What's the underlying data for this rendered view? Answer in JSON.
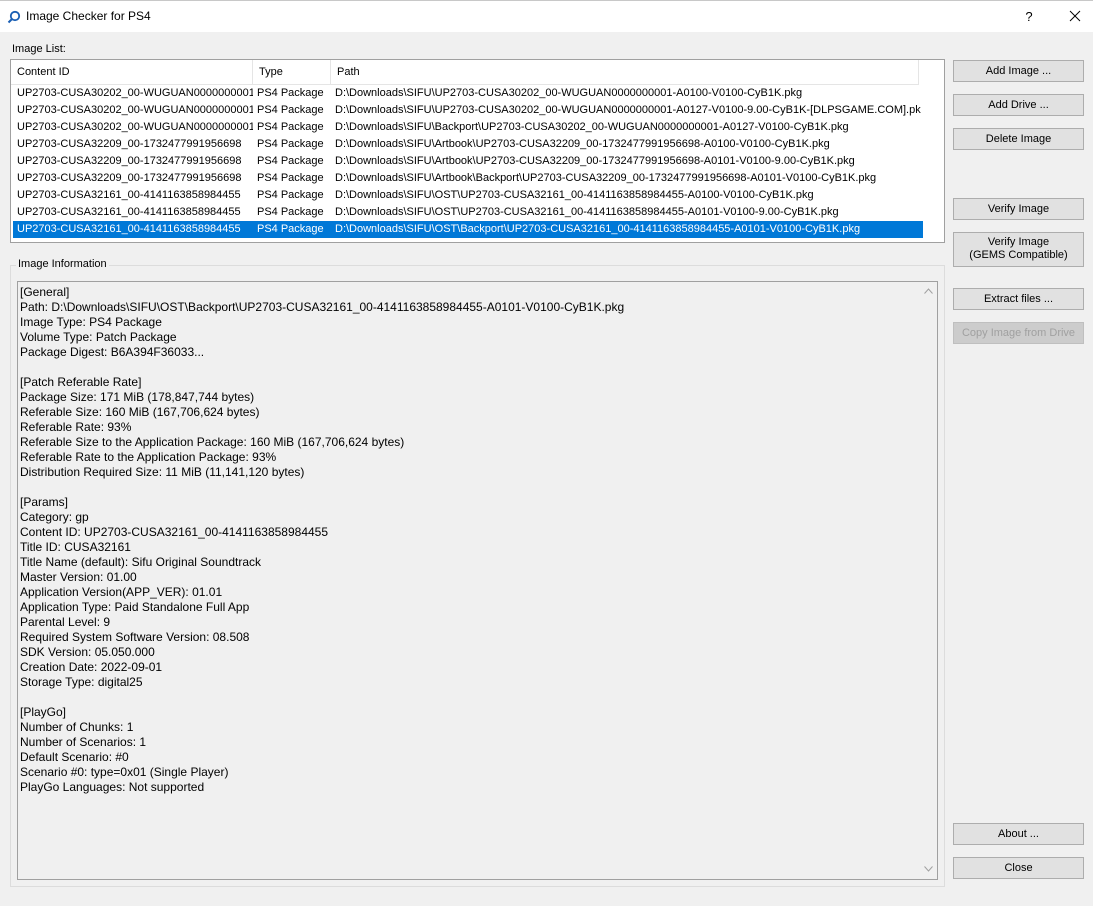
{
  "window": {
    "title": "Image Checker for PS4",
    "help_label": "?"
  },
  "image_list": {
    "label": "Image List:",
    "columns": [
      "Content ID",
      "Type",
      "Path"
    ],
    "rows": [
      [
        "UP2703-CUSA30202_00-WUGUAN0000000001",
        "PS4 Package",
        "D:\\Downloads\\SIFU\\UP2703-CUSA30202_00-WUGUAN0000000001-A0100-V0100-CyB1K.pkg"
      ],
      [
        "UP2703-CUSA30202_00-WUGUAN0000000001",
        "PS4 Package",
        "D:\\Downloads\\SIFU\\UP2703-CUSA30202_00-WUGUAN0000000001-A0127-V0100-9.00-CyB1K-[DLPSGAME.COM].pkg"
      ],
      [
        "UP2703-CUSA30202_00-WUGUAN0000000001",
        "PS4 Package",
        "D:\\Downloads\\SIFU\\Backport\\UP2703-CUSA30202_00-WUGUAN0000000001-A0127-V0100-CyB1K.pkg"
      ],
      [
        "UP2703-CUSA32209_00-1732477991956698",
        "PS4 Package",
        "D:\\Downloads\\SIFU\\Artbook\\UP2703-CUSA32209_00-1732477991956698-A0100-V0100-CyB1K.pkg"
      ],
      [
        "UP2703-CUSA32209_00-1732477991956698",
        "PS4 Package",
        "D:\\Downloads\\SIFU\\Artbook\\UP2703-CUSA32209_00-1732477991956698-A0101-V0100-9.00-CyB1K.pkg"
      ],
      [
        "UP2703-CUSA32209_00-1732477991956698",
        "PS4 Package",
        "D:\\Downloads\\SIFU\\Artbook\\Backport\\UP2703-CUSA32209_00-1732477991956698-A0101-V0100-CyB1K.pkg"
      ],
      [
        "UP2703-CUSA32161_00-4141163858984455",
        "PS4 Package",
        "D:\\Downloads\\SIFU\\OST\\UP2703-CUSA32161_00-4141163858984455-A0100-V0100-CyB1K.pkg"
      ],
      [
        "UP2703-CUSA32161_00-4141163858984455",
        "PS4 Package",
        "D:\\Downloads\\SIFU\\OST\\UP2703-CUSA32161_00-4141163858984455-A0101-V0100-9.00-CyB1K.pkg"
      ],
      [
        "UP2703-CUSA32161_00-4141163858984455",
        "PS4 Package",
        "D:\\Downloads\\SIFU\\OST\\Backport\\UP2703-CUSA32161_00-4141163858984455-A0101-V0100-CyB1K.pkg"
      ]
    ],
    "selected_row": 8
  },
  "image_information": {
    "label": "Image Information",
    "text": "[General]\nPath: D:\\Downloads\\SIFU\\OST\\Backport\\UP2703-CUSA32161_00-4141163858984455-A0101-V0100-CyB1K.pkg\nImage Type: PS4 Package\nVolume Type: Patch Package\nPackage Digest: B6A394F36033...\n\n[Patch Referable Rate]\nPackage Size: 171 MiB (178,847,744 bytes)\nReferable Size: 160 MiB (167,706,624 bytes)\nReferable Rate: 93%\nReferable Size to the Application Package: 160 MiB (167,706,624 bytes)\nReferable Rate to the Application Package: 93%\nDistribution Required Size: 11 MiB (11,141,120 bytes)\n\n[Params]\nCategory: gp\nContent ID: UP2703-CUSA32161_00-4141163858984455\nTitle ID: CUSA32161\nTitle Name (default): Sifu Original Soundtrack\nMaster Version: 01.00\nApplication Version(APP_VER): 01.01\nApplication Type: Paid Standalone Full App\nParental Level: 9\nRequired System Software Version: 08.508\nSDK Version: 05.050.000\nCreation Date: 2022-09-01\nStorage Type: digital25\n\n[PlayGo]\nNumber of Chunks: 1\nNumber of Scenarios: 1\nDefault Scenario: #0\nScenario #0: type=0x01 (Single Player)\nPlayGo Languages: Not supported"
  },
  "buttons": {
    "add_image": "Add Image ...",
    "add_drive": "Add Drive ...",
    "delete_image": "Delete Image",
    "verify_image": "Verify Image",
    "verify_image_gems": "Verify Image\n(GEMS Compatible)",
    "extract_files": "Extract files ...",
    "copy_image_from_drive": "Copy Image from Drive",
    "about": "About ...",
    "close": "Close"
  }
}
